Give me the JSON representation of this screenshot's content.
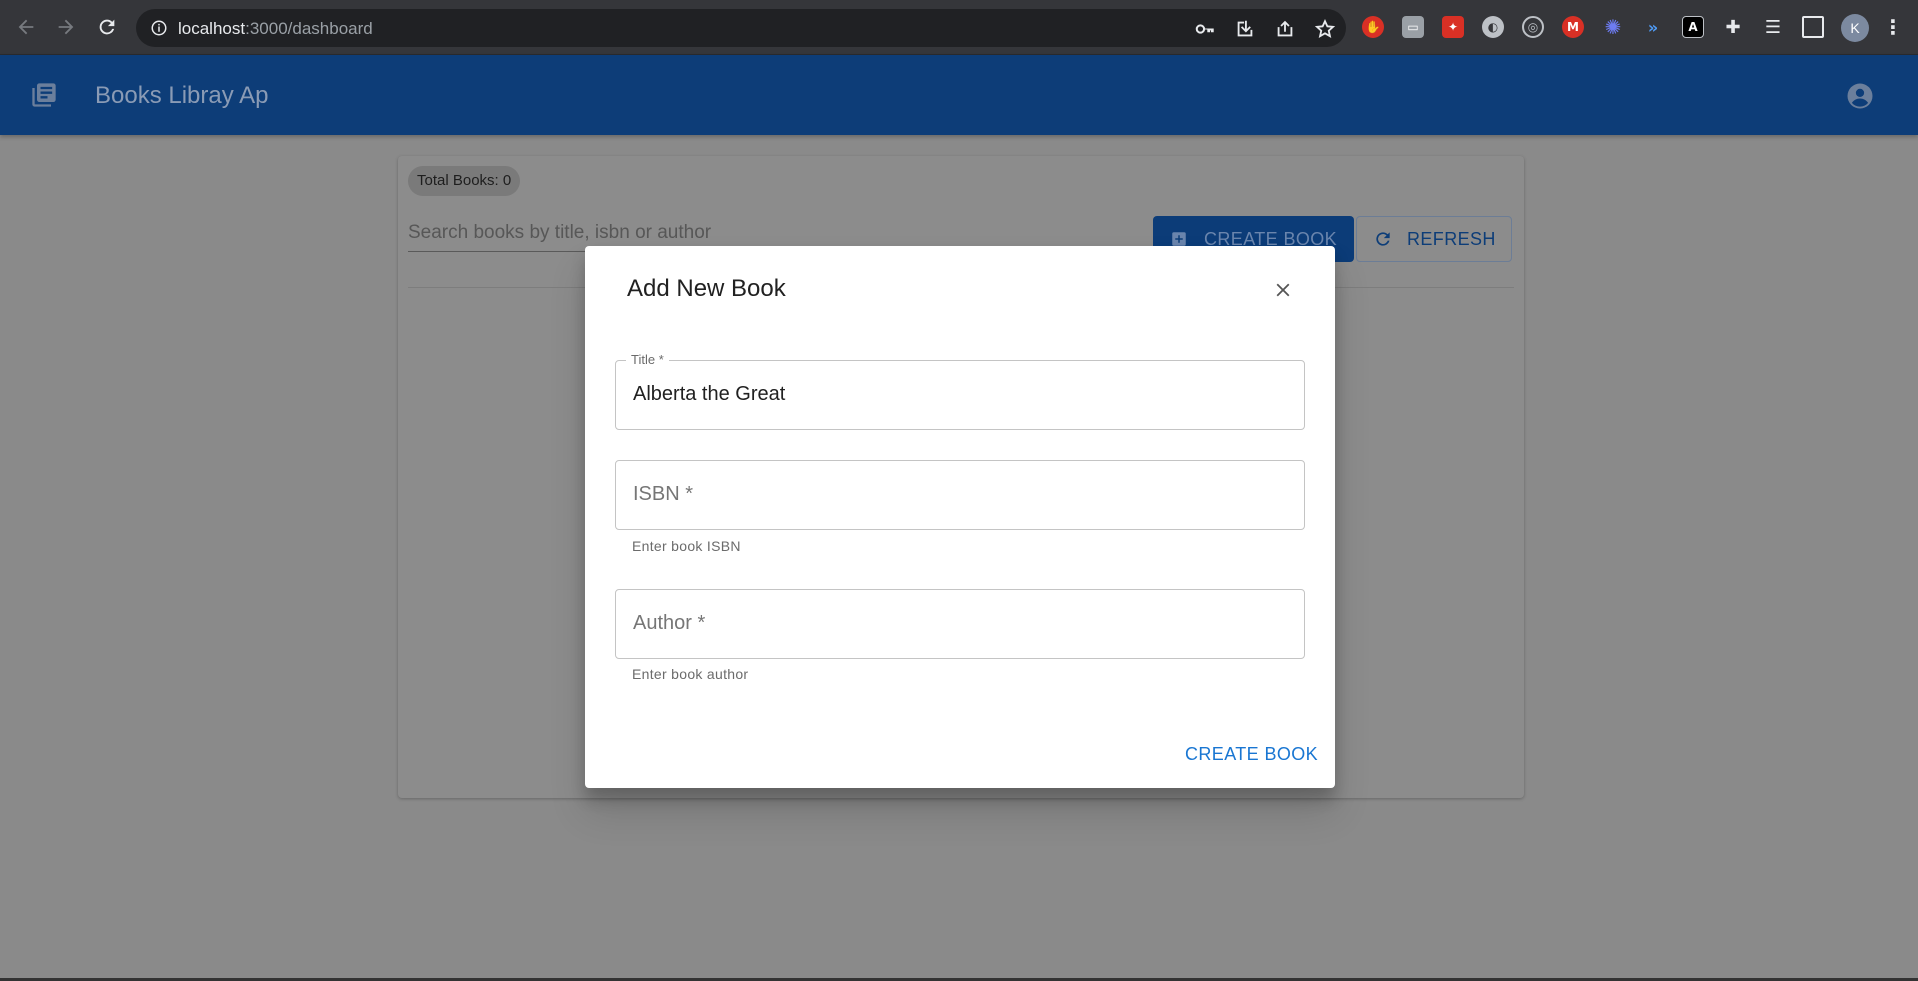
{
  "browser": {
    "url_host": "localhost",
    "url_path": ":3000/dashboard",
    "profile_initial": "K",
    "extensions": [
      {
        "icon": "hand-ext-icon",
        "color": "#d93025"
      },
      {
        "icon": "card-ext-icon",
        "color": "#9aa0a6"
      },
      {
        "icon": "puzzle-red-ext-icon",
        "color": "#d93025"
      },
      {
        "icon": "globe-ext-icon",
        "color": "#bdc1c6"
      },
      {
        "icon": "target-ext-icon",
        "color": "#bdc1c6"
      },
      {
        "icon": "gmail-ext-icon",
        "color": "#d93025"
      },
      {
        "icon": "starburst-ext-icon",
        "color": "#4285f4"
      },
      {
        "icon": "wave-ext-icon",
        "color": "#4f9cf7"
      },
      {
        "icon": "angular-ext-icon",
        "color": "#000000"
      },
      {
        "icon": "extensions-icon",
        "color": "#e8eaed"
      },
      {
        "icon": "reading-list-icon",
        "color": "#e8eaed"
      },
      {
        "icon": "side-panel-icon",
        "color": "#e8eaed"
      }
    ]
  },
  "app": {
    "title": "Books Libray Ap"
  },
  "dashboard": {
    "total_chip": "Total Books: 0",
    "search_placeholder": "Search books by title, isbn or author",
    "create_button": "CREATE BOOK",
    "refresh_button": "REFRESH"
  },
  "dialog": {
    "title": "Add New Book",
    "fields": {
      "title": {
        "label": "Title *",
        "value": "Alberta the Great"
      },
      "isbn": {
        "placeholder": "ISBN *",
        "helper": "Enter book ISBN"
      },
      "author": {
        "placeholder": "Author *",
        "helper": "Enter book author"
      }
    },
    "action": "CREATE BOOK"
  },
  "colors": {
    "appbar": "#0d3d78",
    "overlay": "#8a8a8a",
    "accent": "#1976d2"
  }
}
